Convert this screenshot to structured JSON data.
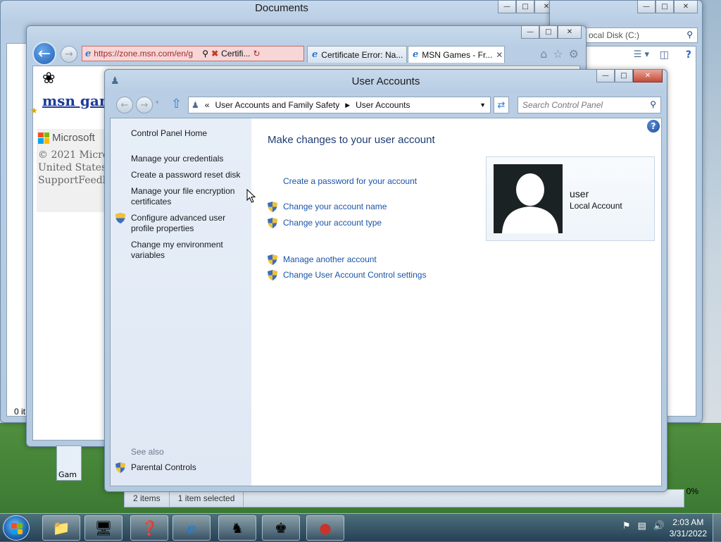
{
  "documents_window": {
    "title": "Documents",
    "status_items": "2 items",
    "status_selected": "1 item selected",
    "left_count": "0 it"
  },
  "disk_window": {
    "search_text": "ocal Disk (C:)",
    "zoom": "0%"
  },
  "ie_window": {
    "url": "https://zone.msn.com/en/g",
    "cert_label": "Certifi...",
    "tabs": [
      "Certificate Error: Na...",
      "MSN Games - Fr..."
    ],
    "msn_games_label": "msn gam",
    "microsoft_label": "Microsoft",
    "footer_lines": [
      "© 2021 Micros",
      "United States",
      "SupportFeedba"
    ],
    "games_tab_label": "Gam"
  },
  "user_accounts": {
    "title": "User Accounts",
    "breadcrumb": [
      "«",
      "User Accounts and Family Safety",
      "User Accounts"
    ],
    "search_placeholder": "Search Control Panel",
    "left_links": {
      "home": "Control Panel Home",
      "credentials": "Manage your credentials",
      "reset_disk": "Create a password reset disk",
      "encryption": "Manage your file encryption certificates",
      "profile": "Configure advanced user profile properties",
      "env": "Change my environment variables"
    },
    "see_also": "See also",
    "parental": "Parental Controls",
    "heading": "Make changes to your user account",
    "tasks": {
      "create_password": "Create a password for your account",
      "change_name": "Change your account name",
      "change_type": "Change your account type",
      "manage_other": "Manage another account",
      "uac": "Change User Account Control settings"
    },
    "user": {
      "name": "user",
      "type": "Local Account"
    }
  },
  "taskbar": {
    "time": "2:03 AM",
    "date": "3/31/2022"
  },
  "icons": {
    "start": "windows-start-orb",
    "explorer": "folder-icon",
    "control_panel": "control-panel-icon",
    "help": "help-icon",
    "ie": "internet-explorer-icon",
    "chess": "chess-icon",
    "solitaire": "cards-icon",
    "game": "game-icon"
  },
  "colors": {
    "link": "#1a54a8",
    "heading": "#1e3c72",
    "cert_error": "#c47070"
  }
}
